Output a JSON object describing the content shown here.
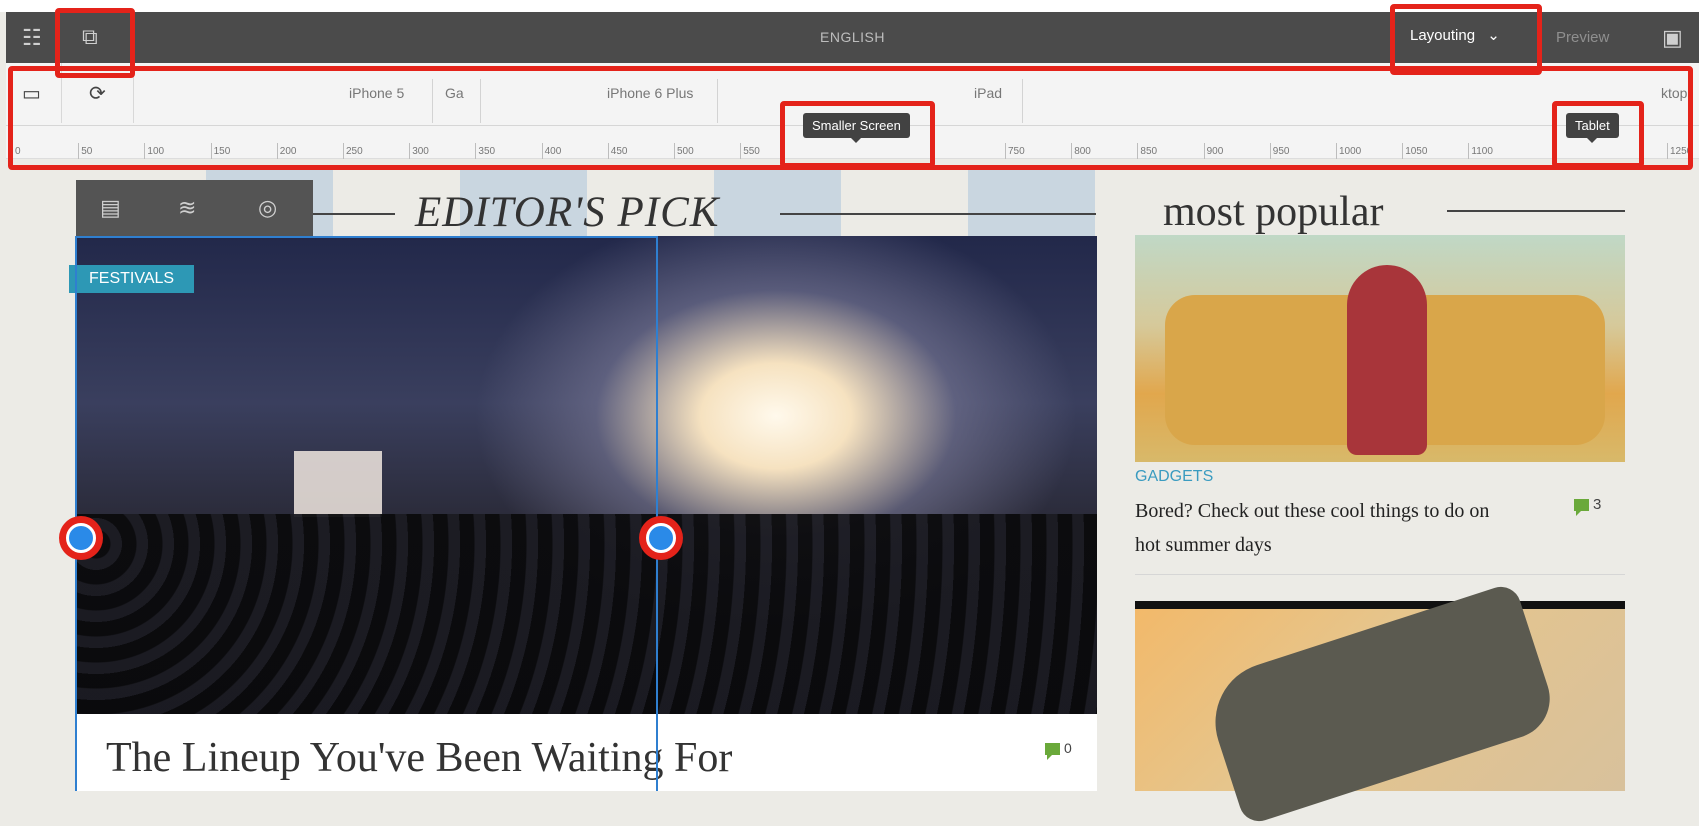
{
  "topbar": {
    "language": "ENGLISH",
    "mode_label": "Layouting",
    "preview_label": "Preview",
    "icons": [
      "sliders-icon",
      "emulator-icon",
      "chevron-down-icon",
      "annotations-icon"
    ]
  },
  "emulator": {
    "devices": [
      "iPhone 5",
      "Ga",
      "iPhone 6 Plus",
      "iPad",
      "ktop"
    ],
    "ruler_labels": [
      "0",
      "50",
      "100",
      "150",
      "200",
      "250",
      "300",
      "350",
      "400",
      "450",
      "500",
      "550",
      "750",
      "800",
      "850",
      "900",
      "950",
      "1000",
      "1050",
      "1100",
      "1250"
    ],
    "tooltips": {
      "smaller_screen": "Smaller Screen",
      "tablet": "Tablet"
    }
  },
  "content": {
    "editors_pick": "EDITOR'S PICK",
    "most_popular": "most popular",
    "festivals_badge": "FESTIVALS",
    "headline": "The Lineup You've Been Waiting For",
    "headline_comments": "0",
    "popular_item": {
      "category": "GADGETS",
      "title": "Bored? Check out these cool things to do on hot summer days",
      "comments": "3"
    }
  },
  "colors": {
    "annotation_red": "#e4231a",
    "accent_blue": "#2a8ae8",
    "badge_teal": "#2d98b5"
  }
}
